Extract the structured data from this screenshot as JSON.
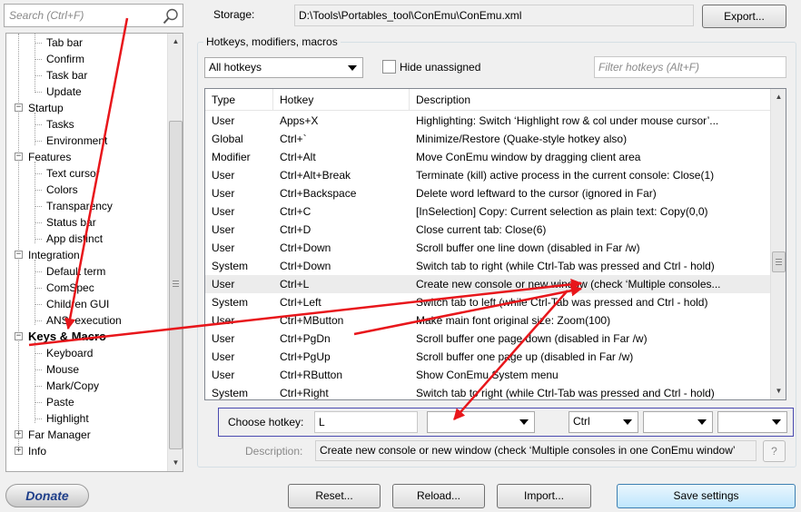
{
  "search": {
    "placeholder": "Search (Ctrl+F)"
  },
  "tree": {
    "items": [
      {
        "label": "Tab bar",
        "level": 1
      },
      {
        "label": "Confirm",
        "level": 1
      },
      {
        "label": "Task bar",
        "level": 1
      },
      {
        "label": "Update",
        "level": 1
      },
      {
        "label": "Startup",
        "level": 0,
        "expander": "−"
      },
      {
        "label": "Tasks",
        "level": 1
      },
      {
        "label": "Environment",
        "level": 1
      },
      {
        "label": "Features",
        "level": 0,
        "expander": "−"
      },
      {
        "label": "Text cursor",
        "level": 1
      },
      {
        "label": "Colors",
        "level": 1
      },
      {
        "label": "Transparency",
        "level": 1
      },
      {
        "label": "Status bar",
        "level": 1
      },
      {
        "label": "App distinct",
        "level": 1
      },
      {
        "label": "Integration",
        "level": 0,
        "expander": "−"
      },
      {
        "label": "Default term",
        "level": 1
      },
      {
        "label": "ComSpec",
        "level": 1
      },
      {
        "label": "Children GUI",
        "level": 1
      },
      {
        "label": "ANSI execution",
        "level": 1
      },
      {
        "label": "Keys & Macro",
        "level": 0,
        "expander": "−",
        "selected": true
      },
      {
        "label": "Keyboard",
        "level": 1
      },
      {
        "label": "Mouse",
        "level": 1
      },
      {
        "label": "Mark/Copy",
        "level": 1
      },
      {
        "label": "Paste",
        "level": 1
      },
      {
        "label": "Highlight",
        "level": 1
      },
      {
        "label": "Far Manager",
        "level": 0,
        "expander": "+"
      },
      {
        "label": "Info",
        "level": 0,
        "expander": "+"
      }
    ]
  },
  "storage": {
    "label": "Storage:",
    "path": "D:\\Tools\\Portables_tool\\ConEmu\\ConEmu.xml",
    "export_label": "Export..."
  },
  "group": {
    "title": "Hotkeys, modifiers, macros"
  },
  "filter": {
    "type_value": "All hotkeys",
    "hide_unassigned_label": "Hide unassigned",
    "hide_unassigned_checked": false,
    "filter_placeholder": "Filter hotkeys (Alt+F)"
  },
  "table": {
    "headers": [
      "Type",
      "Hotkey",
      "Description"
    ],
    "rows": [
      [
        "User",
        "Apps+X",
        "Highlighting: Switch ‘Highlight row & col under mouse cursor’..."
      ],
      [
        "Global",
        "Ctrl+`",
        "Minimize/Restore (Quake-style hotkey also)"
      ],
      [
        "Modifier",
        "Ctrl+Alt",
        "Move ConEmu window by dragging client area"
      ],
      [
        "User",
        "Ctrl+Alt+Break",
        "Terminate (kill) active process in the current console: Close(1)"
      ],
      [
        "User",
        "Ctrl+Backspace",
        "Delete word leftward to the cursor (ignored in Far)"
      ],
      [
        "User",
        "Ctrl+C",
        "[InSelection] Copy: Current selection as plain text: Copy(0,0)"
      ],
      [
        "User",
        "Ctrl+D",
        "Close current tab: Close(6)"
      ],
      [
        "User",
        "Ctrl+Down",
        "Scroll buffer one line down (disabled in Far /w)"
      ],
      [
        "System",
        "Ctrl+Down",
        "Switch tab to right (while Ctrl-Tab was pressed and Ctrl - hold)"
      ],
      [
        "User",
        "Ctrl+L",
        "Create new console or new window (check ‘Multiple consoles..."
      ],
      [
        "System",
        "Ctrl+Left",
        "Switch tab to left (while Ctrl-Tab was pressed and Ctrl - hold)"
      ],
      [
        "User",
        "Ctrl+MButton",
        "Make main font original size: Zoom(100)"
      ],
      [
        "User",
        "Ctrl+PgDn",
        "Scroll buffer one page down (disabled in Far /w)"
      ],
      [
        "User",
        "Ctrl+PgUp",
        "Scroll buffer one page up (disabled in Far /w)"
      ],
      [
        "User",
        "Ctrl+RButton",
        "Show ConEmu System menu"
      ],
      [
        "System",
        "Ctrl+Right",
        "Switch tab to right (while Ctrl-Tab was pressed and Ctrl - hold)"
      ]
    ],
    "highlighted_row": 9
  },
  "hotkey": {
    "choose_label": "Choose hotkey:",
    "key_value": "L",
    "modifier_1": "",
    "modifier_2": "Ctrl",
    "modifier_3": "",
    "modifier_4": ""
  },
  "description": {
    "label": "Description:",
    "value": "Create new console or new window (check ‘Multiple consoles in one ConEmu window’",
    "help_label": "?"
  },
  "buttons": {
    "donate": "Donate",
    "reset": "Reset...",
    "reload": "Reload...",
    "import": "Import...",
    "save": "Save settings"
  },
  "colors": {
    "annotation_arrow": "#e8161b",
    "hotkey_box_border": "#4a4ab0",
    "row_highlight": "#ececec"
  }
}
